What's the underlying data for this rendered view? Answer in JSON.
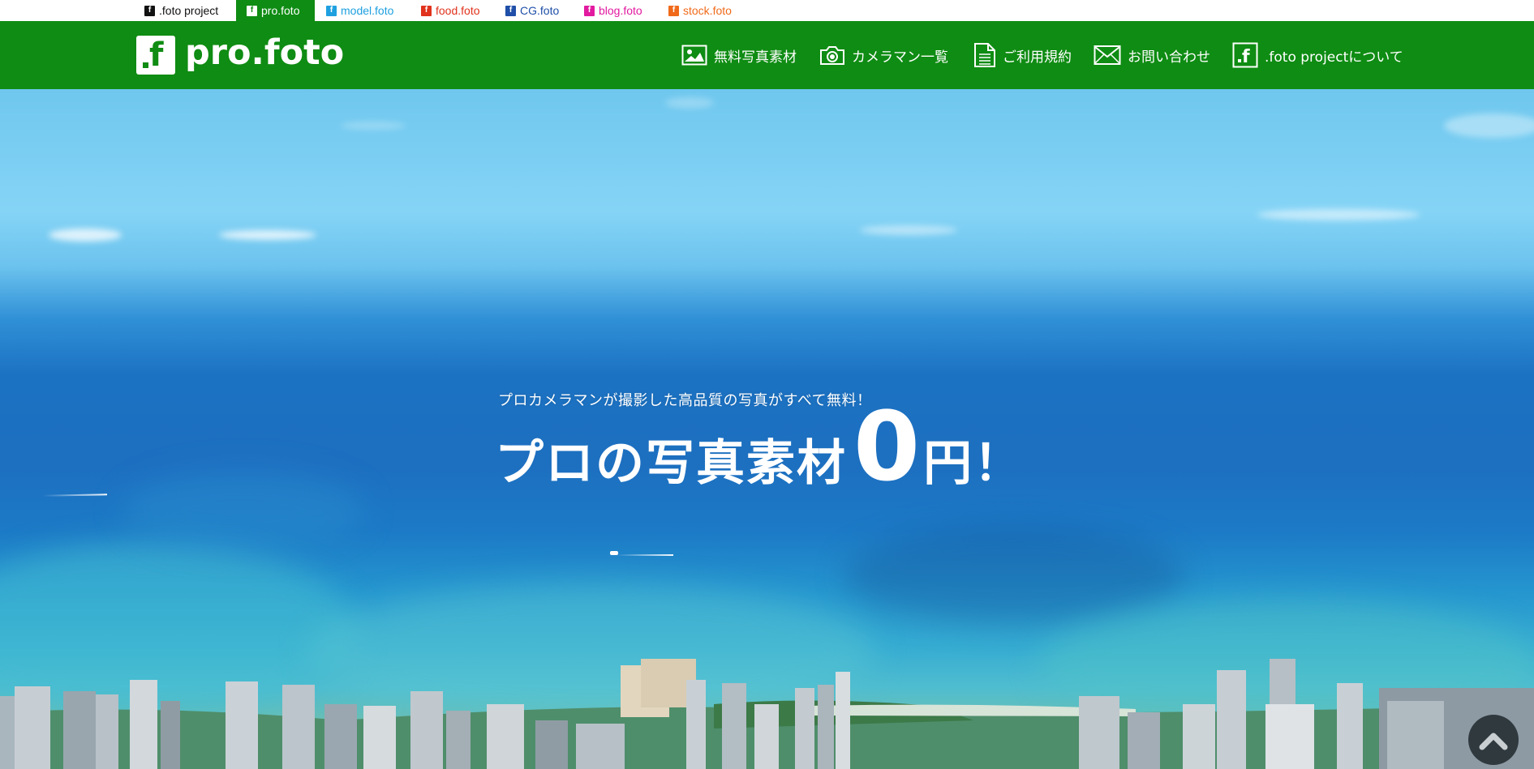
{
  "project_tabs": [
    {
      "label": ".foto project",
      "color": "#111111",
      "active": false
    },
    {
      "label": "pro.foto",
      "color": "#0f8c13",
      "active": true
    },
    {
      "label": "model.foto",
      "color": "#1ea0e0",
      "active": false
    },
    {
      "label": "food.foto",
      "color": "#e0321c",
      "active": false
    },
    {
      "label": "CG.foto",
      "color": "#1f4fa8",
      "active": false
    },
    {
      "label": "blog.foto",
      "color": "#e21aa0",
      "active": false
    },
    {
      "label": "stock.foto",
      "color": "#f06a1a",
      "active": false
    }
  ],
  "header": {
    "logo_text": "pro.foto",
    "logo_glyph": "f",
    "brand_color": "#0f8c13",
    "nav": [
      {
        "label": "無料写真素材",
        "icon": "image-icon"
      },
      {
        "label": "カメラマン一覧",
        "icon": "camera-icon"
      },
      {
        "label": "ご利用規約",
        "icon": "document-icon"
      },
      {
        "label": "お問い合わせ",
        "icon": "mail-icon"
      },
      {
        "label": ".foto projectについて",
        "icon": "foto-logo-icon"
      }
    ]
  },
  "hero": {
    "subtitle": "プロカメラマンが撮影した高品質の写真がすべて無料！",
    "title_main": "プロの写真素材",
    "title_zero": "0",
    "title_end": "円！"
  },
  "scroll_top": {
    "icon": "chevron-up-icon"
  }
}
